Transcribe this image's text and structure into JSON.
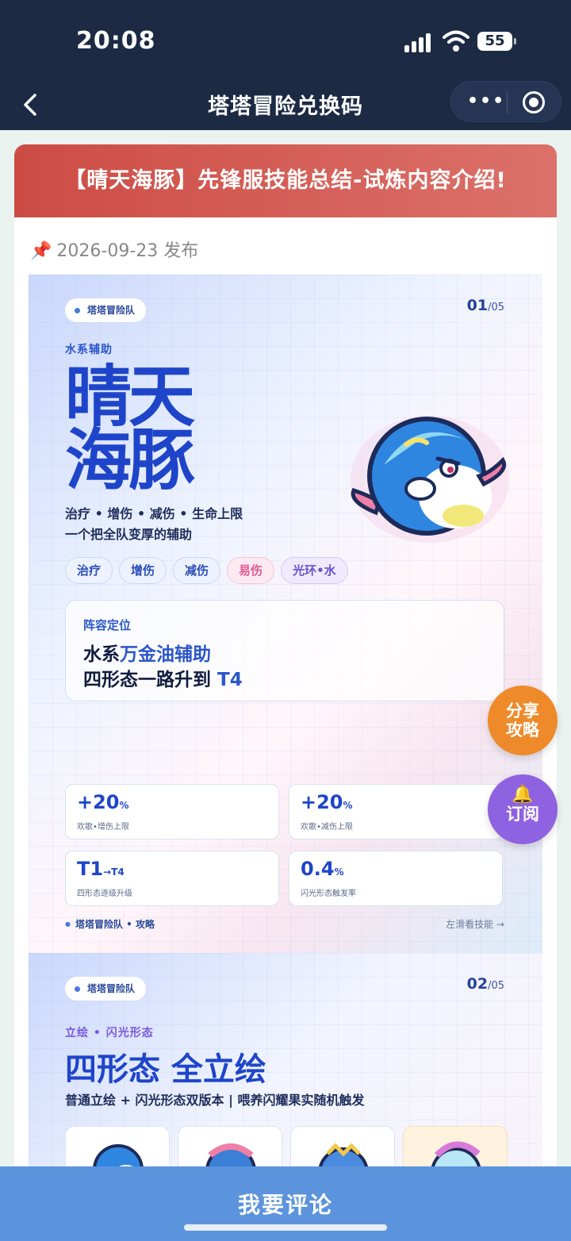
{
  "status": {
    "time": "20:08",
    "battery": "55"
  },
  "nav": {
    "title": "塔塔冒险兑换码"
  },
  "article": {
    "title": "【晴天海豚】先锋服技能总结-试炼内容介绍!",
    "publish": "2026-09-23 发布"
  },
  "slide1": {
    "team": "塔塔冒险队",
    "page": "01",
    "page_total": "/05",
    "category": "水系辅助",
    "title_line1": "晴天",
    "title_line2": "海豚",
    "subtitle1": "治疗 • 增伤 • 减伤 • 生命上限",
    "subtitle2": "一个把全队变厚的辅助",
    "tags": [
      "治疗",
      "增伤",
      "减伤",
      "易伤",
      "光环•水"
    ],
    "position_label": "阵容定位",
    "position_l1a": "水系",
    "position_l1b": "万金油辅助",
    "position_l2a": "四形态一路升到 ",
    "position_l2b": "T4",
    "stats": [
      {
        "value": "+20",
        "unit": "%",
        "label": "欢歌•增伤上限"
      },
      {
        "value": "+20",
        "unit": "%",
        "label": "欢歌•减伤上限"
      },
      {
        "value": "T1",
        "unit": "→T4",
        "label": "四形态逐级升级"
      },
      {
        "value": "0.4",
        "unit": "%",
        "label": "闪光形态触发率"
      }
    ],
    "footer_left": "塔塔冒险队 • 攻略",
    "footer_right": "左滑看技能 →"
  },
  "slide2": {
    "team": "塔塔冒险队",
    "page": "02",
    "page_total": "/05",
    "category": "立绘 • 闪光形态",
    "title": "四形态 全立绘",
    "subtitle": "普通立绘 + 闪光形态双版本 | 喂养闪耀果实随机触发"
  },
  "fab": {
    "share": "分享攻略",
    "share_l1": "分享",
    "share_l2": "攻略",
    "subscribe": "订阅"
  },
  "bottom": {
    "comment": "我要评论"
  },
  "colors": {
    "nav_bg": "#1c2a44",
    "header_red": "#cc4c44",
    "accent_blue": "#1e45c9",
    "comment_bar": "#5b94dc",
    "share_orange": "#ee8a2a",
    "subscribe_purple": "#8e62e0"
  }
}
